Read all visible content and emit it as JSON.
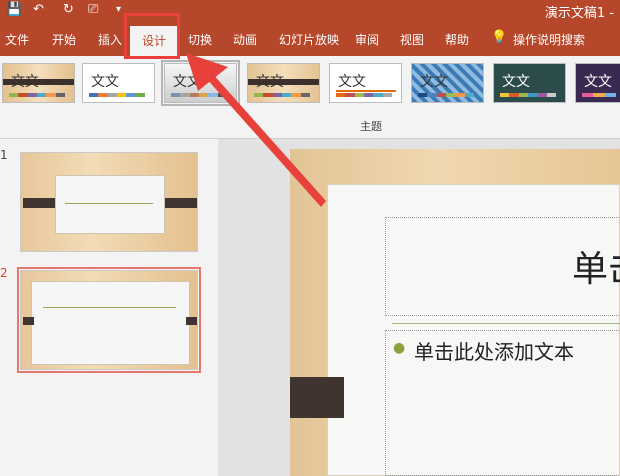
{
  "title_bar": {
    "doc_title": "演示文稿1 -"
  },
  "quick_access": {
    "save": "💾",
    "undo": "↶",
    "redo": "↻",
    "present": "⎚",
    "more": "▾"
  },
  "tabs": [
    {
      "label": "文件"
    },
    {
      "label": "开始"
    },
    {
      "label": "插入"
    },
    {
      "label": "设计"
    },
    {
      "label": "切换"
    },
    {
      "label": "动画"
    },
    {
      "label": "幻灯片放映"
    },
    {
      "label": "审阅"
    },
    {
      "label": "视图"
    },
    {
      "label": "帮助"
    },
    {
      "label": "操作说明搜索"
    }
  ],
  "themes": {
    "group_label": "主题",
    "sample_text": "文文"
  },
  "slides": [
    {
      "number": "1"
    },
    {
      "number": "2"
    }
  ],
  "slide_content": {
    "title_placeholder": "单击",
    "body_placeholder": "单击此处添加文本"
  }
}
